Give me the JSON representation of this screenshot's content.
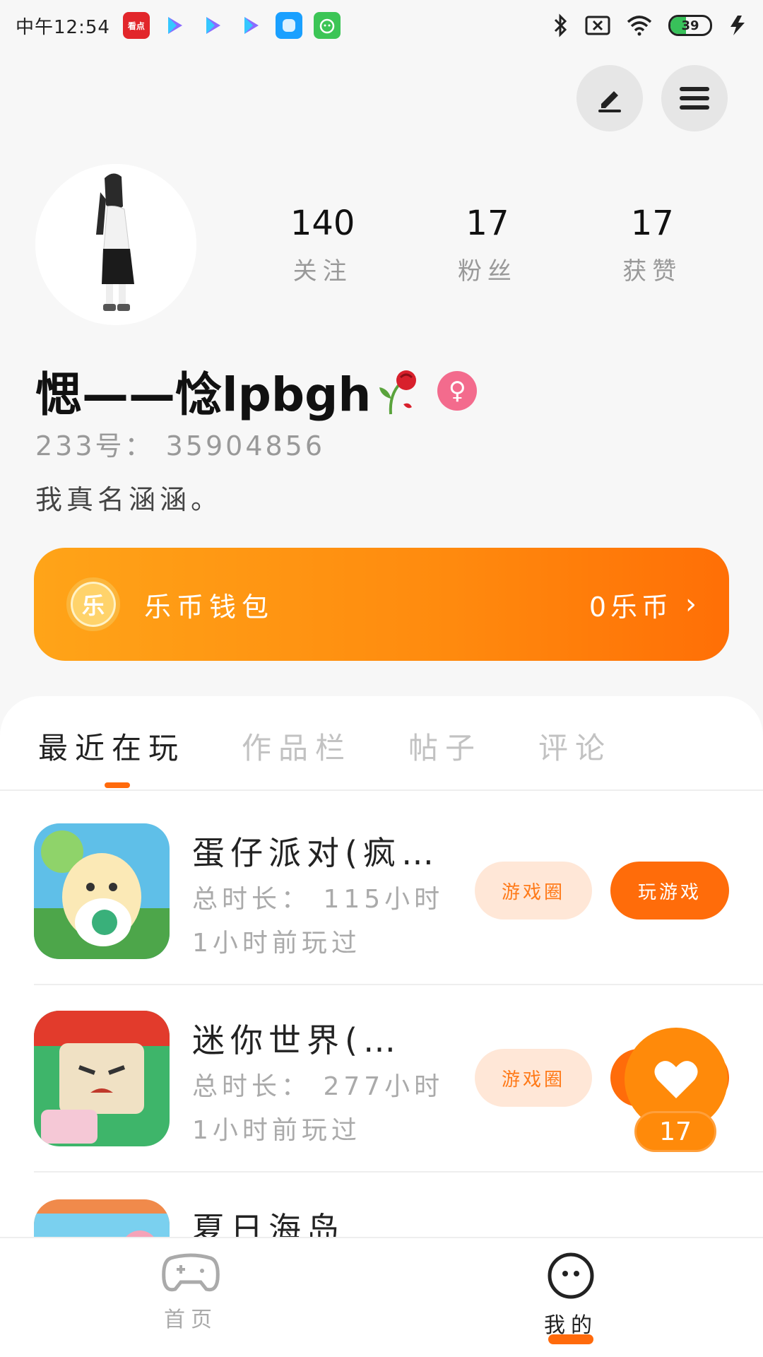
{
  "status_bar": {
    "time": "中午12:54",
    "apps": [
      "看点",
      "",
      "",
      "",
      "",
      ""
    ],
    "battery": "39",
    "battery_level": 0.39
  },
  "profile": {
    "stats": [
      {
        "value": "140",
        "label": "关注"
      },
      {
        "value": "17",
        "label": "粉丝"
      },
      {
        "value": "17",
        "label": "获赞"
      }
    ],
    "username": "愢——惗lpbgh",
    "uid": "233号： 35904856",
    "bio": "我真名涵涵。",
    "gender_symbol": "♀"
  },
  "wallet": {
    "coin_glyph": "乐",
    "label": "乐币钱包",
    "value": "0乐币",
    "chevron": "›"
  },
  "tabs": [
    {
      "label": "最近在玩",
      "active": true
    },
    {
      "label": "作品栏",
      "active": false
    },
    {
      "label": "帖子",
      "active": false
    },
    {
      "label": "评论",
      "active": false
    }
  ],
  "games": [
    {
      "title": "蛋仔派对(疯…",
      "duration": "总时长： 115小时",
      "last_played": "1小时前玩过",
      "circle_label": "游戏圈",
      "play_label": "玩游戏"
    },
    {
      "title": "迷你世界(…",
      "duration": "总时长： 277小时",
      "last_played": "1小时前玩过",
      "circle_label": "游戏圈",
      "play_label": "玩游戏"
    },
    {
      "title": "夏日海岛"
    }
  ],
  "like_float": {
    "count": "17"
  },
  "bottom_nav": {
    "home": "首页",
    "mine": "我的"
  },
  "colors": {
    "accent": "#ff6a0c",
    "wallet_start": "#ffa418",
    "wallet_end": "#ff6f06",
    "gender": "#f36b8d"
  }
}
